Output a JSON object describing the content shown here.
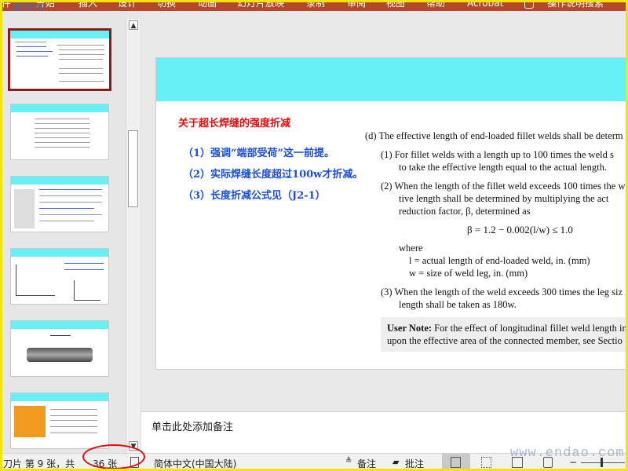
{
  "ribbon": {
    "tabs": [
      "件",
      "开始",
      "插入",
      "设计",
      "切换",
      "动画",
      "幻灯片放映",
      "录制",
      "审阅",
      "视图",
      "帮助",
      "Acrobat",
      "操作说明搜索"
    ]
  },
  "slide": {
    "title": "关于超长焊缝的强度折减",
    "points": [
      "（1）强调“端部受荷”这一前提。",
      "（2）实际焊缝长度超过100w才折减。",
      "（3）长度折减公式见（J2-1）"
    ],
    "standard": {
      "d": "(d)  The effective length of end-loaded fillet welds shall be determ",
      "p1a": "(1)  For fillet welds with a length up to 100 times the weld s",
      "p1b": "to take the effective length equal to the actual length.",
      "p2a": "(2)  When the length of the fillet weld exceeds 100 times the w",
      "p2b": "tive length shall be determined by multiplying the act",
      "p2c": "reduction factor, β, determined as",
      "formula": "β = 1.2 − 0.002(l/w) ≤ 1.0",
      "where": "where",
      "wl": "l  = actual length of end-loaded weld, in. (mm)",
      "ww": "w = size of weld leg, in. (mm)",
      "p3a": "(3)  When the length of the weld exceeds 300 times the leg siz",
      "p3b": "length shall be taken as 180w.",
      "note_label": "User Note:",
      "note_a": " For the effect of longitudinal fillet weld length in",
      "note_b": "upon the effective area of the connected member, see Sectio"
    }
  },
  "notes_placeholder": "单击此处添加备注",
  "status": {
    "slide_info": "刀片 第 9 张，共",
    "total": "36 张",
    "language": "简体中文(中国大陆)",
    "notes_btn": "备注",
    "comments_btn": "批注"
  },
  "watermark_tl": "道桥网",
  "watermark_br": "www.endao.com",
  "colors": {
    "ribbon": "#b7472a",
    "slide_band": "#66f0f6",
    "title_red": "#e01010",
    "point_blue": "#1a4fd6",
    "frame_yellow": "#f2e600"
  }
}
